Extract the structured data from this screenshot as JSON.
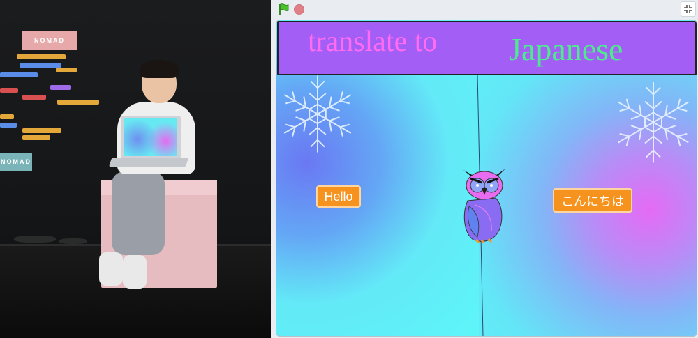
{
  "photo": {
    "poster_top": "NOMAD",
    "poster_bottom": "NOMAD",
    "box_logo": "NOMAD"
  },
  "scratch": {
    "controls": {
      "flag_icon": "green-flag-icon",
      "stop_icon": "stop-icon",
      "fullscreen_icon": "fullscreen-icon"
    },
    "banner": {
      "title_left": "translate to",
      "title_right": "Japanese"
    },
    "buttons": {
      "hello": "Hello",
      "japanese": "こんにちは"
    },
    "sprites": {
      "owl": "owl-icon",
      "snowflake": "snowflake-icon"
    },
    "colors": {
      "banner_bg": "#a35ef6",
      "title_left": "#ff6cf2",
      "title_right": "#4dea8f",
      "button_bg": "#f5931e",
      "stage_cyan": "#62eef7",
      "left_glow": "#6a78f3",
      "right_glow": "#e56bf5"
    }
  }
}
